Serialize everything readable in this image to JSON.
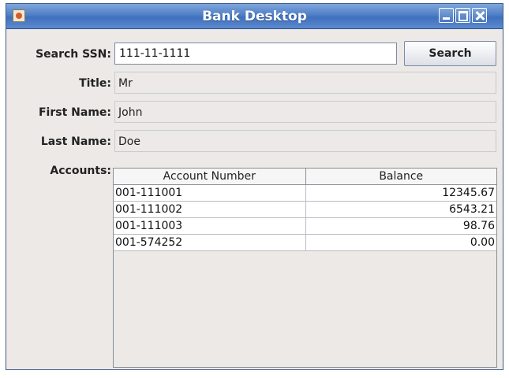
{
  "window": {
    "title": "Bank Desktop"
  },
  "form": {
    "search_label": "Search SSN:",
    "ssn_value": "111-11-1111",
    "search_button": "Search",
    "title_label": "Title:",
    "title_value": "Mr",
    "first_name_label": "First Name:",
    "first_name_value": "John",
    "last_name_label": "Last Name:",
    "last_name_value": "Doe",
    "accounts_label": "Accounts:"
  },
  "accounts": {
    "columns": [
      "Account Number",
      "Balance"
    ],
    "rows": [
      {
        "number": "001-111001",
        "balance": "12345.67"
      },
      {
        "number": "001-111002",
        "balance": "6543.21"
      },
      {
        "number": "001-111003",
        "balance": "98.76"
      },
      {
        "number": "001-574252",
        "balance": "0.00"
      }
    ]
  }
}
